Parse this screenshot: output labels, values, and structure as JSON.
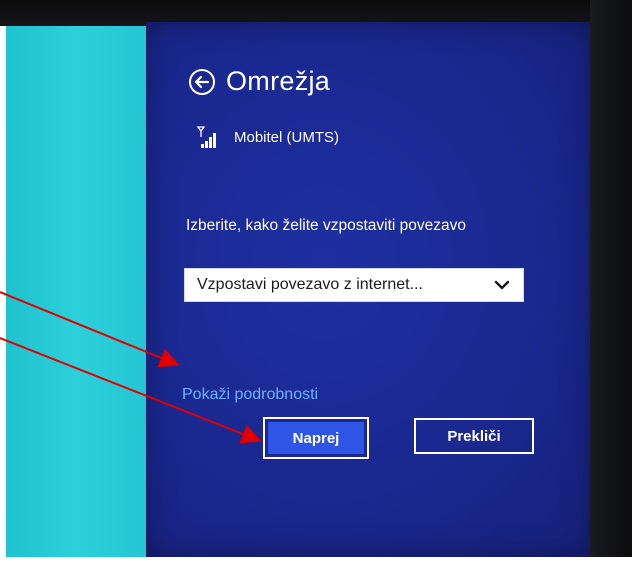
{
  "panel": {
    "title": "Omrežja",
    "network_name": "Mobitel (UMTS)",
    "prompt": "Izberite, kako želite vzpostaviti povezavo",
    "connection_select": {
      "selected": "Vzpostavi povezavo z internet..."
    },
    "details_link": "Pokaži podrobnosti",
    "next_button": "Naprej",
    "cancel_button": "Prekliči"
  },
  "colors": {
    "panel_bg": "#1a2890",
    "start_screen_teal": "#2cd0da",
    "link": "#6fb2ff",
    "primary_button": "#2e55e6",
    "annotation_arrow": "#e00000"
  },
  "icons": {
    "back": "back-arrow-circle-icon",
    "signal": "mobile-signal-icon",
    "dropdown": "chevron-down-icon"
  }
}
